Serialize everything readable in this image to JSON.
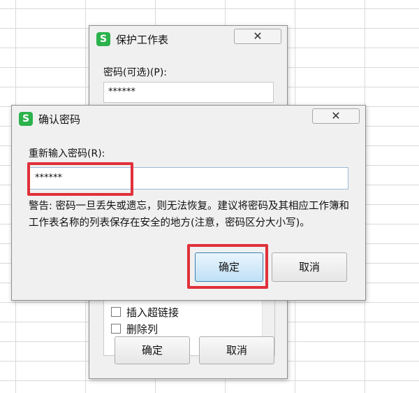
{
  "protect_dialog": {
    "title": "保护工作表",
    "close_glyph": "✕",
    "password_label": "密码(可选)(P):",
    "password_value": "******",
    "options": [
      {
        "label": "插入超链接",
        "checked": false
      },
      {
        "label": "删除列",
        "checked": false
      }
    ],
    "ok_label": "确定",
    "cancel_label": "取消"
  },
  "confirm_dialog": {
    "title": "确认密码",
    "close_glyph": "✕",
    "reenter_label": "重新输入密码(R):",
    "password_value": "******",
    "warning_text": "警告: 密码一旦丢失或遗忘，则无法恢复。建议将密码及其相应工作簿和工作表名称的列表保存在安全的地方(注意，密码区分大小写)。",
    "ok_label": "确定",
    "cancel_label": "取消"
  },
  "app_icon_letter": "S",
  "colors": {
    "app_icon": "#2bb24c",
    "highlight": "#e0313a",
    "default_button": "#bfe0f6"
  }
}
